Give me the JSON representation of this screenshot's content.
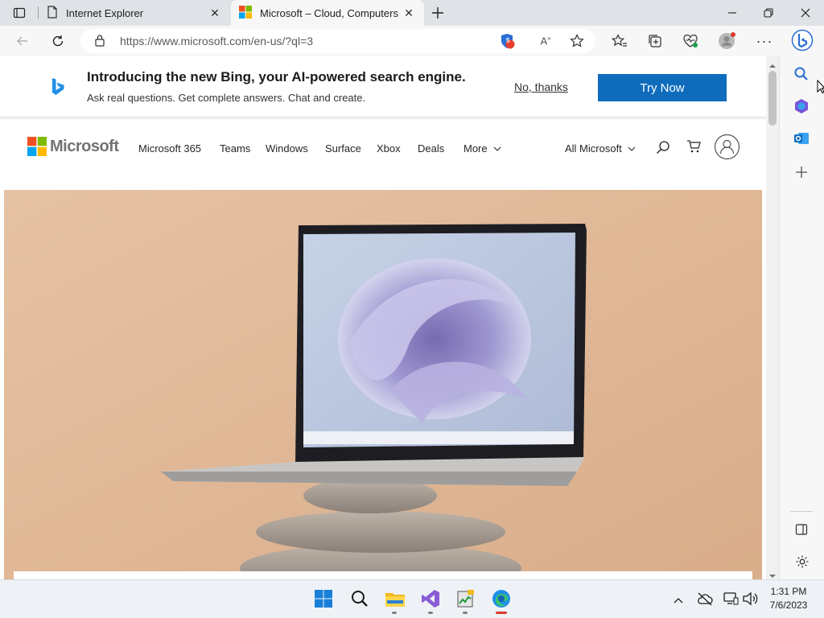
{
  "browser": {
    "tabs": [
      {
        "label": "Internet Explorer",
        "icon": "page-icon",
        "active": false
      },
      {
        "label": "Microsoft – Cloud, Computers, Apps & Gaming",
        "icon": "microsoft-logo-icon",
        "active": true
      }
    ],
    "address": {
      "url": "https://www.microsoft.com/en-us/?ql=3"
    },
    "extension_badge": "5",
    "window_controls": [
      "minimize-icon",
      "restore-icon",
      "close-icon"
    ]
  },
  "bing_banner": {
    "title": "Introducing the new Bing, your AI-powered search engine.",
    "subtitle": "Ask real questions. Get complete answers. Chat and create.",
    "dismiss_label": "No, thanks",
    "cta_label": "Try Now"
  },
  "ms_header": {
    "logo_text": "Microsoft",
    "nav": [
      "Microsoft 365",
      "Teams",
      "Windows",
      "Surface",
      "Xbox",
      "Deals",
      "More"
    ],
    "all_microsoft": "All Microsoft"
  },
  "taskbar": {
    "time": "1:31 PM",
    "date": "7/6/2023"
  },
  "colors": {
    "accent": "#0f6cbd",
    "hero_bg": "#dbb292",
    "tabstrip": "#dfe2e6"
  }
}
